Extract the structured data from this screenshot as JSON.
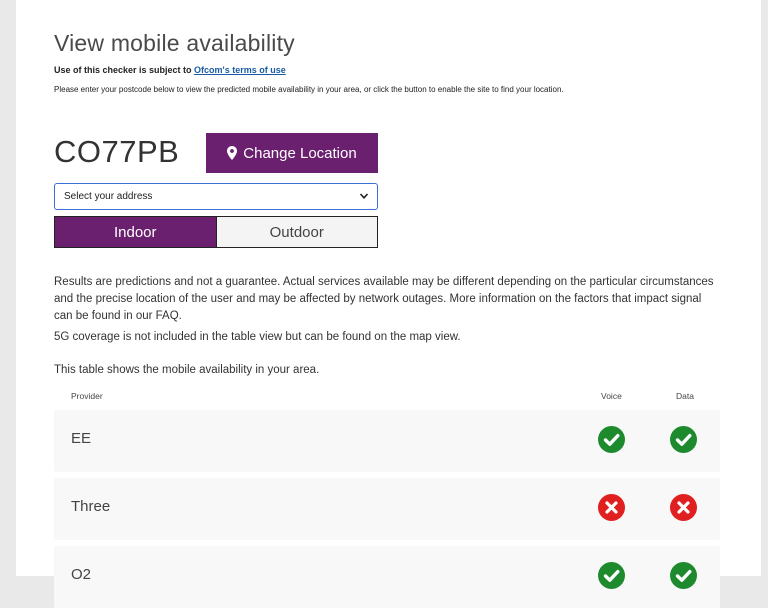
{
  "header": {
    "title": "View mobile availability",
    "terms_prefix": "Use of this checker is subject to ",
    "terms_link": "Ofcom's terms of use",
    "instructions": "Please enter your postcode below to view the predicted mobile availability in your area, or click the button to enable the site to find your location."
  },
  "location": {
    "postcode": "CO77PB",
    "change_button": "Change Location",
    "address_placeholder": "Select your address"
  },
  "toggle": {
    "indoor": "Indoor",
    "outdoor": "Outdoor",
    "selected": "Indoor"
  },
  "info": {
    "disclaimer": "Results are predictions and not a guarantee. Actual services available may be different depending on the particular circumstances and the precise location of the user and may be affected by network outages. More information on the factors that impact signal can be found in our FAQ.",
    "note_5g": "5G coverage is not included in the table view but can be found on the map view.",
    "table_intro": "This table shows the mobile availability in your area."
  },
  "table": {
    "headers": {
      "provider": "Provider",
      "voice": "Voice",
      "data": "Data"
    },
    "rows": [
      {
        "provider": "EE",
        "voice": "available",
        "data": "available"
      },
      {
        "provider": "Three",
        "voice": "unavailable",
        "data": "unavailable"
      },
      {
        "provider": "O2",
        "voice": "available",
        "data": "available"
      }
    ]
  },
  "colors": {
    "accent": "#6b1f6f",
    "available": "#1e8a2e",
    "unavailable": "#e02020",
    "link": "#1a5aa6"
  },
  "icons": {
    "location": "map-pin-icon",
    "select": "chevron-down-icon",
    "available": "check-circle-icon",
    "unavailable": "cross-circle-icon"
  }
}
